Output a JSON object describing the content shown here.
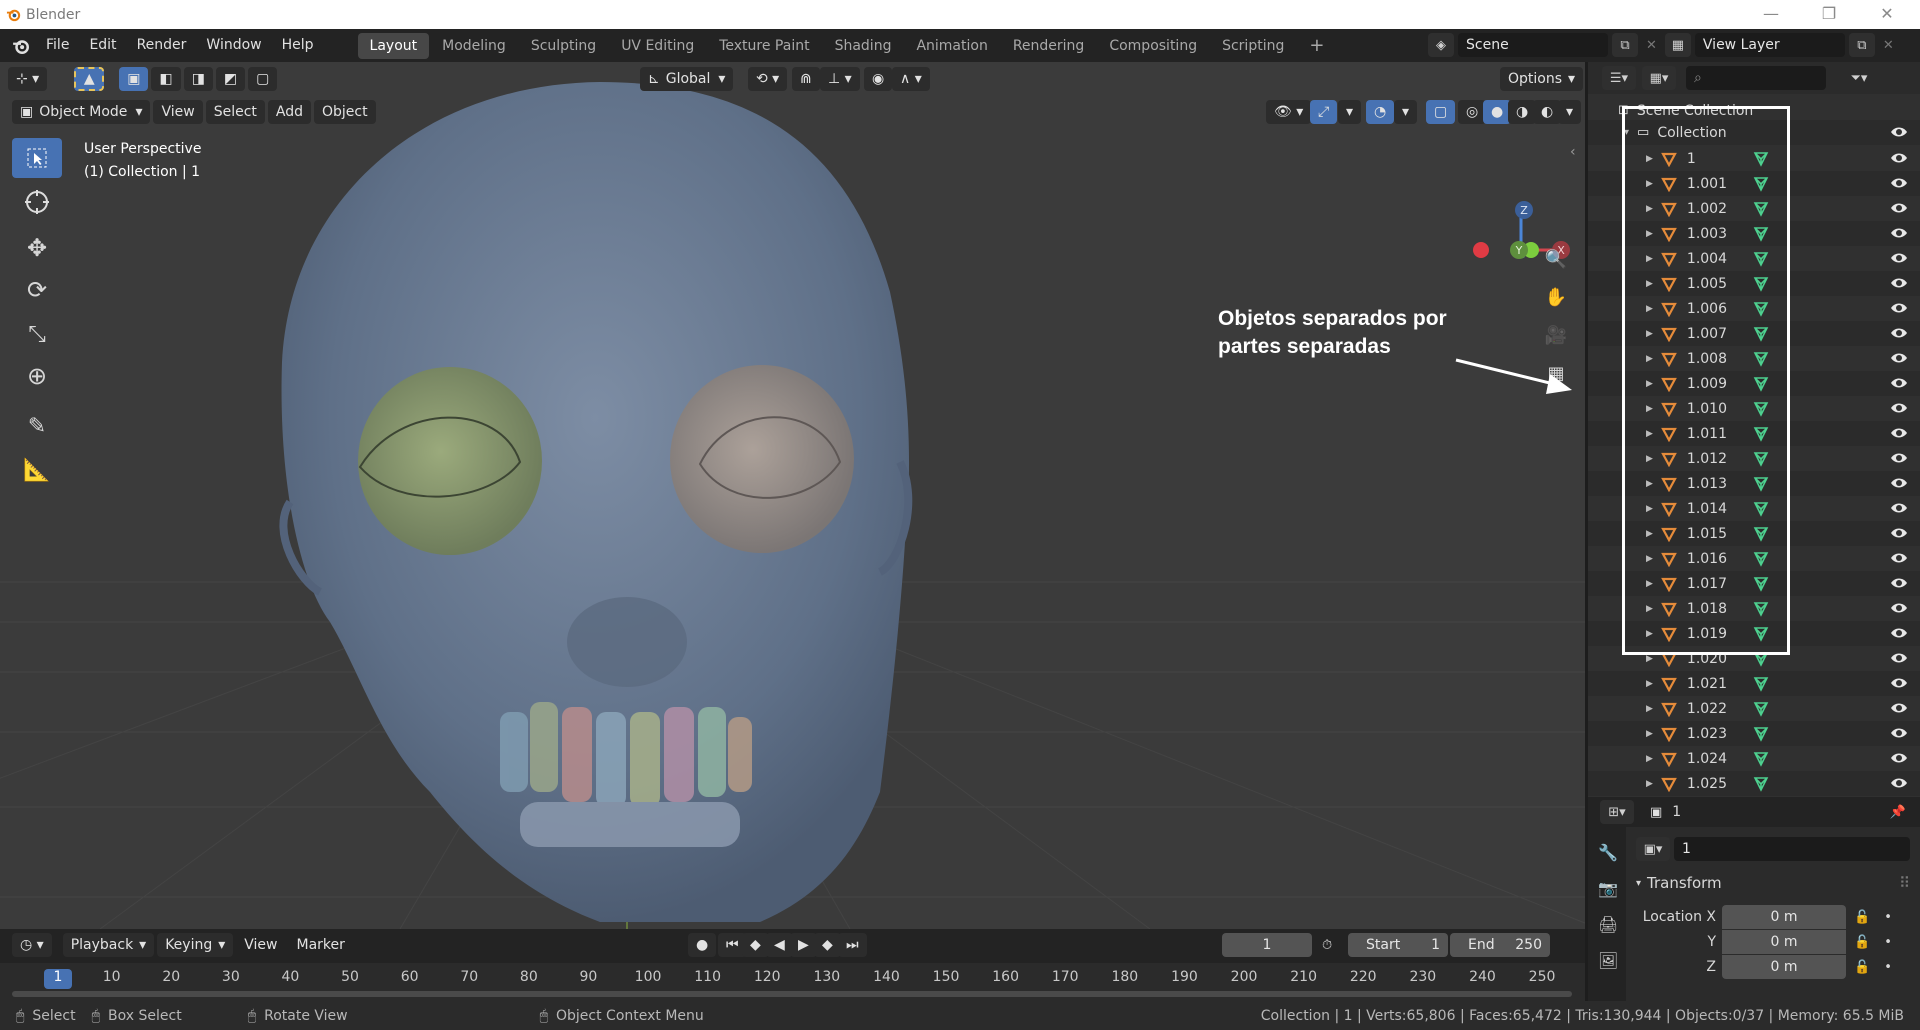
{
  "app": {
    "title": "Blender"
  },
  "menu": [
    "File",
    "Edit",
    "Render",
    "Window",
    "Help"
  ],
  "workspaces": [
    "Layout",
    "Modeling",
    "Sculpting",
    "UV Editing",
    "Texture Paint",
    "Shading",
    "Animation",
    "Rendering",
    "Compositing",
    "Scripting"
  ],
  "active_workspace": "Layout",
  "scene": {
    "name": "Scene",
    "view_layer": "View Layer"
  },
  "viewport": {
    "transform_orientation": "Global",
    "options_label": "Options",
    "mode": "Object Mode",
    "header_menus": [
      "View",
      "Select",
      "Add",
      "Object"
    ],
    "overlay_title": "User Perspective",
    "overlay_sub": "(1) Collection | 1",
    "gizmo_axes": {
      "z": "Z",
      "y": "Y",
      "x": "X"
    }
  },
  "annotation": {
    "line1": "Objetos separados por",
    "line2": "partes separadas"
  },
  "outliner": {
    "root": "Scene Collection",
    "collection": "Collection",
    "objects": [
      "1",
      "1.001",
      "1.002",
      "1.003",
      "1.004",
      "1.005",
      "1.006",
      "1.007",
      "1.008",
      "1.009",
      "1.010",
      "1.011",
      "1.012",
      "1.013",
      "1.014",
      "1.015",
      "1.016",
      "1.017",
      "1.018",
      "1.019",
      "1.020",
      "1.021",
      "1.022",
      "1.023",
      "1.024",
      "1.025"
    ]
  },
  "properties": {
    "object_name": "1",
    "field_name": "1",
    "panel_title": "Transform",
    "location_label": "Location X",
    "y_label": "Y",
    "z_label": "Z",
    "location": [
      "0 m",
      "0 m",
      "0 m"
    ]
  },
  "timeline": {
    "menus": [
      "Playback",
      "Keying",
      "View",
      "Marker"
    ],
    "current_frame": "1",
    "start_label": "Start",
    "start": "1",
    "end_label": "End",
    "end": "250",
    "ticks": [
      "1",
      "10",
      "20",
      "30",
      "40",
      "50",
      "60",
      "70",
      "80",
      "90",
      "100",
      "110",
      "120",
      "130",
      "140",
      "150",
      "160",
      "170",
      "180",
      "190",
      "200",
      "210",
      "220",
      "230",
      "240",
      "250"
    ]
  },
  "statusbar": {
    "select": "Select",
    "box_select": "Box Select",
    "rotate": "Rotate View",
    "context": "Object Context Menu",
    "stats": "Collection | 1 | Verts:65,806 | Faces:65,472 | Tris:130,944 | Objects:0/37 | Memory: 65.5 MiB"
  },
  "colors": {
    "accent": "#4772b3",
    "mesh_orange": "#e58b3a",
    "data_green": "#4dd08f",
    "selection_box": "#ffffff"
  }
}
